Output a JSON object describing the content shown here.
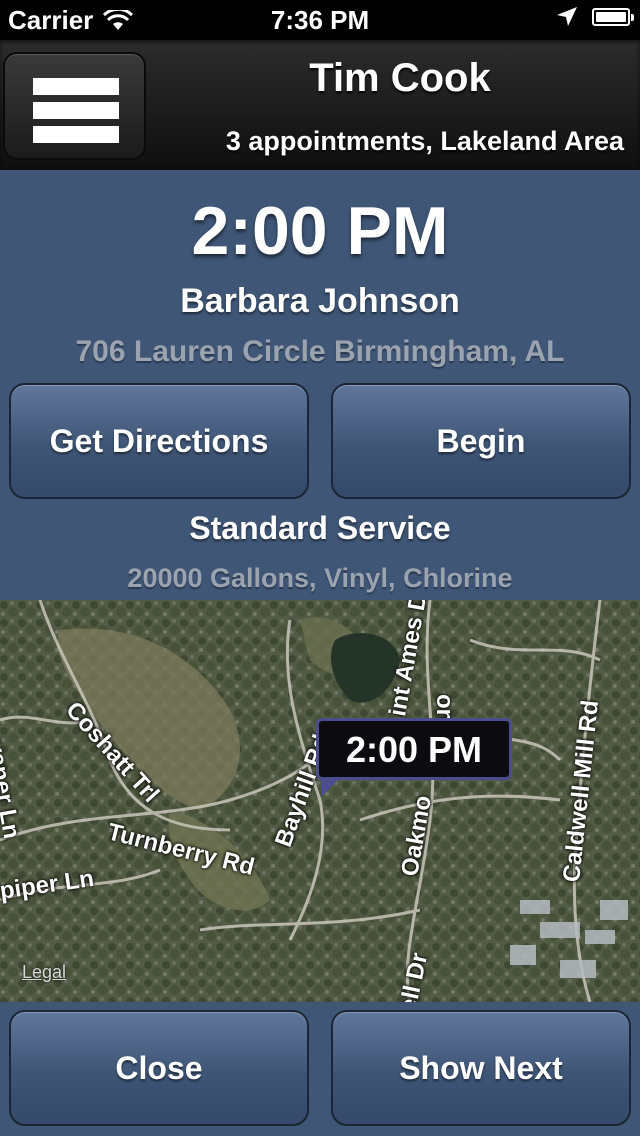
{
  "status_bar": {
    "carrier": "Carrier",
    "time": "7:36 PM"
  },
  "header": {
    "name": "Tim Cook",
    "subtitle": "3 appointments, Lakeland Area",
    "menu_icon": "hamburger-menu-icon"
  },
  "appointment": {
    "time": "2:00 PM",
    "client": "Barbara Johnson",
    "address": "706 Lauren Circle Birmingham, AL",
    "service": "Standard Service",
    "details": "20000 Gallons, Vinyl, Chlorine"
  },
  "buttons": {
    "directions": "Get Directions",
    "begin": "Begin",
    "close": "Close",
    "next": "Show Next"
  },
  "map": {
    "pin_label": "2:00 PM",
    "legal": "Legal",
    "streets": [
      "Coshatt Trl",
      "Turnberry Rd",
      "Bayhill Rd",
      "Oakmont Rd",
      "Caldwell Mill Rd",
      "Piper Ln",
      "Saint Ames Dr",
      "Oakmont Rd (north)",
      "Lanier Ln (partial)",
      "Dell Dr (partial)"
    ],
    "street_text": {
      "coshatt": "Coshatt Trl",
      "turnberry": "Turnberry Rd",
      "bayhill": "Bayhill Rd",
      "oakmont": "Oakmo",
      "caldwell": "Caldwell Mill Rd",
      "piper": "piper Ln",
      "ames": "int Ames Dr",
      "oakmont_n": "ont Rd",
      "lanier": "vaner Ln",
      "dell": "ell Dr"
    }
  }
}
